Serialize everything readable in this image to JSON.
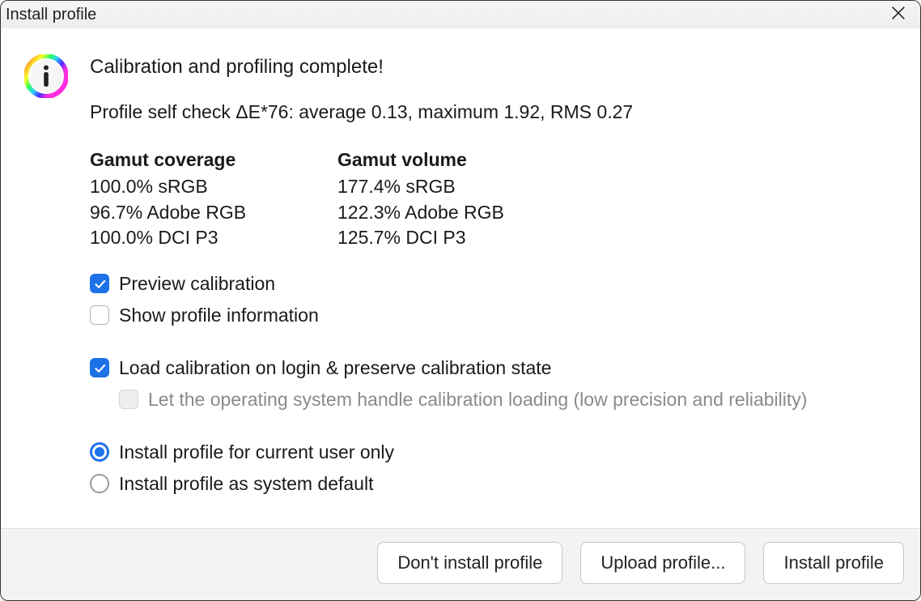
{
  "window": {
    "title": "Install profile"
  },
  "headline": "Calibration and profiling complete!",
  "selfcheck": "Profile self check ΔE*76: average 0.13, maximum 1.92, RMS 0.27",
  "gamut": {
    "coverage": {
      "heading": "Gamut coverage",
      "srgb": "100.0% sRGB",
      "adobe": "96.7% Adobe RGB",
      "dcip3": "100.0% DCI P3"
    },
    "volume": {
      "heading": "Gamut volume",
      "srgb": "177.4% sRGB",
      "adobe": "122.3% Adobe RGB",
      "dcip3": "125.7% DCI P3"
    }
  },
  "options": {
    "preview_calibration": {
      "label": "Preview calibration",
      "checked": true
    },
    "show_profile_info": {
      "label": "Show profile information",
      "checked": false
    },
    "load_on_login": {
      "label": "Load calibration on login & preserve calibration state",
      "checked": true
    },
    "os_handle": {
      "label": "Let the operating system handle calibration loading (low precision and reliability)",
      "checked": false,
      "disabled": true
    }
  },
  "radios": {
    "current_user": {
      "label": "Install profile for current user only",
      "selected": true
    },
    "system_default": {
      "label": "Install profile as system default",
      "selected": false
    }
  },
  "buttons": {
    "dont_install": "Don't install profile",
    "upload": "Upload profile...",
    "install": "Install profile"
  }
}
